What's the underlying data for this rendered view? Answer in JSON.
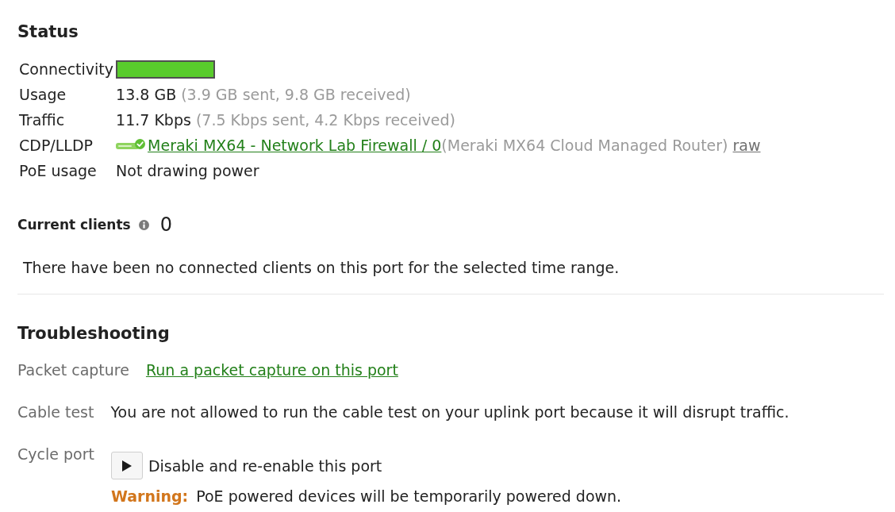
{
  "status": {
    "title": "Status",
    "rows": [
      {
        "kind": "connectivity",
        "label": "Connectivity",
        "segments": [
          {
            "kind": "online"
          }
        ]
      },
      {
        "kind": "text",
        "label": "Usage",
        "value": "13.8 GB",
        "detail": "(3.9 GB sent, 9.8 GB received)"
      },
      {
        "kind": "text",
        "label": "Traffic",
        "value": "11.7 Kbps",
        "detail": "(7.5 Kbps sent, 4.2 Kbps received)"
      },
      {
        "kind": "neighbor",
        "label": "CDP/LLDP",
        "link": "Meraki MX64 - Network Lab Firewall / 0",
        "detail": "(Meraki MX64 Cloud Managed Router)",
        "raw_link": "raw"
      },
      {
        "kind": "text",
        "label": "PoE usage",
        "value": "Not drawing power"
      }
    ]
  },
  "current_clients": {
    "title": "Current clients",
    "count": "0",
    "message": "There have been no connected clients on this port for the selected time range."
  },
  "troubleshooting": {
    "title": "Troubleshooting",
    "rows": [
      {
        "kind": "link",
        "label": "Packet capture",
        "link": "Run a packet capture on this port"
      },
      {
        "kind": "text",
        "label": "Cable test",
        "value": "You are not allowed to run the cable test on your uplink port because it will disrupt traffic."
      },
      {
        "kind": "action",
        "label": "Cycle port",
        "action": "Disable and re-enable this port",
        "warning": "**Warning:** PoE powered devices will be temporarily powered down."
      }
    ]
  }
}
